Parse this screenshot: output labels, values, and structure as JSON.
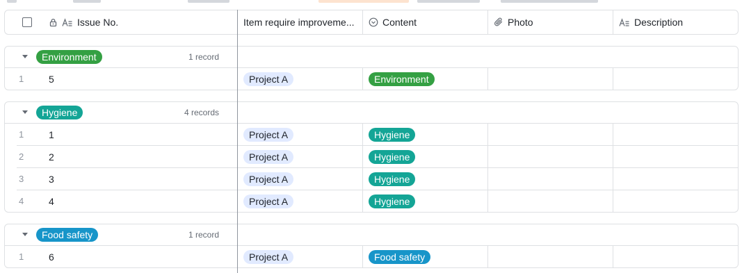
{
  "colors": {
    "environment": "#34a043",
    "hygiene": "#14a596",
    "food_safety": "#1795c9",
    "project_chip": "#e1eaff",
    "border": "#dee0e3"
  },
  "header": {
    "columns": [
      {
        "label": "Issue No.",
        "icon": "text-field-icon"
      },
      {
        "label": "Item require improveme...",
        "icon": ""
      },
      {
        "label": "Content",
        "icon": "single-select-icon"
      },
      {
        "label": "Photo",
        "icon": "attachment-icon"
      },
      {
        "label": "Description",
        "icon": "text-field-icon"
      }
    ]
  },
  "groups": [
    {
      "label": "Environment",
      "count": "1 record",
      "rows": [
        {
          "index": "1",
          "issue": "5",
          "item": "Project A",
          "content": "Environment"
        }
      ]
    },
    {
      "label": "Hygiene",
      "count": "4 records",
      "rows": [
        {
          "index": "1",
          "issue": "1",
          "item": "Project A",
          "content": "Hygiene"
        },
        {
          "index": "2",
          "issue": "2",
          "item": "Project A",
          "content": "Hygiene"
        },
        {
          "index": "3",
          "issue": "3",
          "item": "Project A",
          "content": "Hygiene"
        },
        {
          "index": "4",
          "issue": "4",
          "item": "Project A",
          "content": "Hygiene"
        }
      ]
    },
    {
      "label": "Food safety",
      "count": "1 record",
      "rows": [
        {
          "index": "1",
          "issue": "6",
          "item": "Project A",
          "content": "Food safety"
        }
      ]
    }
  ]
}
